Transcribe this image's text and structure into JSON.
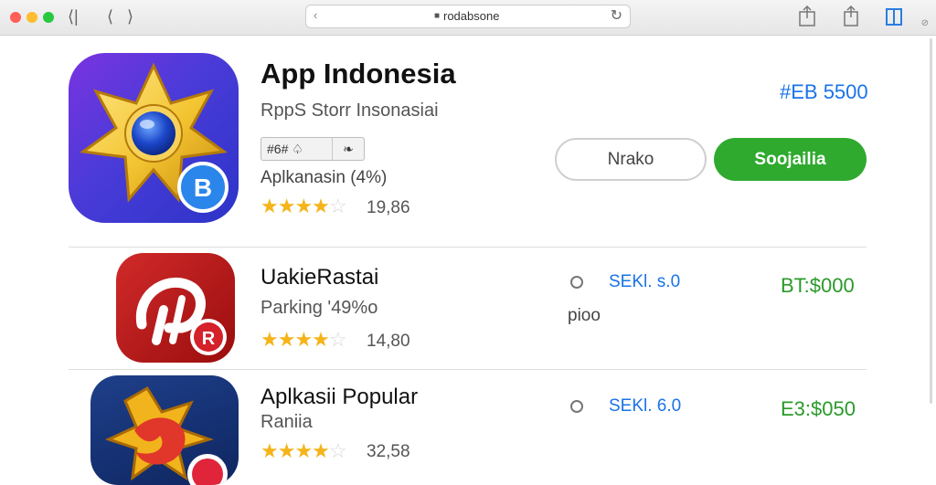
{
  "browser": {
    "url": "rodabsone",
    "colors": {
      "close": "#ff5f57",
      "minimize": "#febc2e",
      "zoom": "#28c840"
    }
  },
  "featured": {
    "title": "App Indonesia",
    "subtitle": "RppS Storr  Insonasiai",
    "badge_left": "#6#  ♤",
    "badge_right": "❧",
    "category": "Aplkanasin (4%)",
    "rating": 4.5,
    "rating_count": "19,86",
    "price": "#EB 5500",
    "button_secondary": "Nrako",
    "button_primary": "Soojailia",
    "icon": "star-gem-icon",
    "icon_badge_letter": "B",
    "accent_color": "#2faa2f"
  },
  "rows": [
    {
      "title": "UakieRastai",
      "subtitle": "Parking '49%o",
      "rating": 4.5,
      "rating_count": "14,80",
      "size": "SEKl. s.0",
      "extra": "pioo",
      "price": "BT:$000",
      "icon": "parking-p-icon",
      "icon_badge_letter": "R"
    },
    {
      "title": "Aplkasii Popular",
      "subtitle": "Raniia",
      "rating": 4.5,
      "rating_count": "32,58",
      "size": "SEKl. 6.0",
      "price": "E3:$050",
      "icon": "flame-star-icon"
    }
  ]
}
